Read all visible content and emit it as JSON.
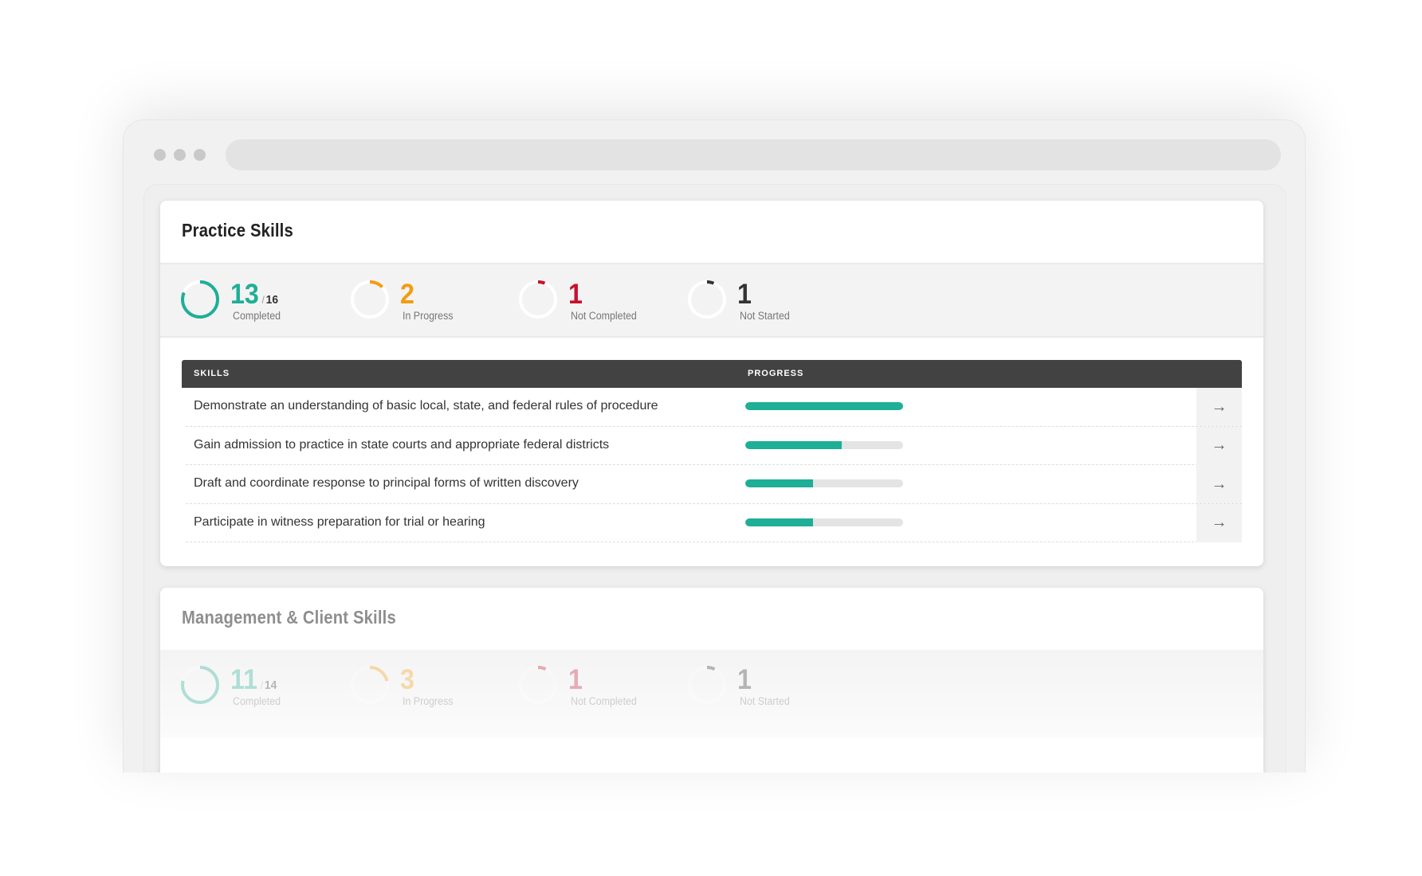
{
  "colors": {
    "completed": "#1eaf96",
    "in_progress": "#f39c12",
    "not_completed": "#c8102e",
    "not_started": "#333333",
    "header_bg": "#424242"
  },
  "practice": {
    "title": "Practice Skills",
    "stats": [
      {
        "value": "13",
        "total": "16",
        "label": "Completed",
        "fraction": 0.8125
      },
      {
        "value": "2",
        "label": "In Progress",
        "fraction": 0.125
      },
      {
        "value": "1",
        "label": "Not Completed",
        "fraction": 0.0625
      },
      {
        "value": "1",
        "label": "Not Started",
        "fraction": 0.0625
      }
    ],
    "table": {
      "col_skills": "SKILLS",
      "col_progress": "PROGRESS",
      "rows": [
        {
          "skill": "Demonstrate an understanding of basic local, state, and federal rules of procedure",
          "progress": 1.0
        },
        {
          "skill": "Gain admission to practice in state courts and appropriate federal districts",
          "progress": 0.61
        },
        {
          "skill": "Draft and coordinate response to principal forms of written discovery",
          "progress": 0.43
        },
        {
          "skill": "Participate in witness preparation for trial or hearing",
          "progress": 0.43
        }
      ]
    }
  },
  "management": {
    "title": "Management & Client Skills",
    "stats": [
      {
        "value": "11",
        "total": "14",
        "label": "Completed",
        "fraction": 0.7857
      },
      {
        "value": "3",
        "label": "In Progress",
        "fraction": 0.2143
      },
      {
        "value": "1",
        "label": "Not Completed",
        "fraction": 0.0714
      },
      {
        "value": "1",
        "label": "Not Started",
        "fraction": 0.0714
      }
    ]
  }
}
